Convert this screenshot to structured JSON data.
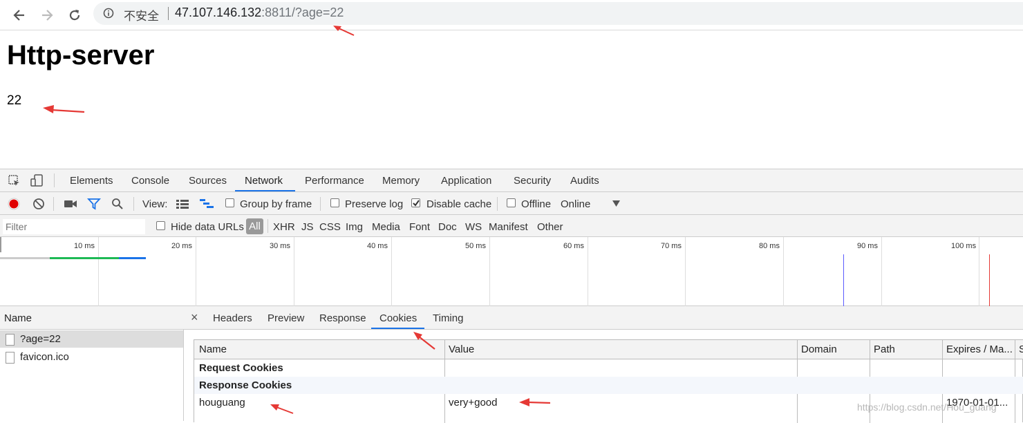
{
  "browser": {
    "security_label": "不安全",
    "url_host": "47.107.146.132",
    "url_rest": ":8811/?age=22"
  },
  "page": {
    "title": "Http-server",
    "value": "22"
  },
  "devtools": {
    "tabs": [
      "Elements",
      "Console",
      "Sources",
      "Network",
      "Performance",
      "Memory",
      "Application",
      "Security",
      "Audits"
    ],
    "active_tab": "Network",
    "toolbar": {
      "view_label": "View:",
      "group_by_frame": "Group by frame",
      "preserve_log": "Preserve log",
      "disable_cache": "Disable cache",
      "offline": "Offline",
      "throttle": "Online"
    },
    "filter": {
      "placeholder": "Filter",
      "hide_data_urls": "Hide data URLs",
      "types": [
        "All",
        "XHR",
        "JS",
        "CSS",
        "Img",
        "Media",
        "Font",
        "Doc",
        "WS",
        "Manifest",
        "Other"
      ]
    },
    "overview_ticks": [
      "10 ms",
      "20 ms",
      "30 ms",
      "40 ms",
      "50 ms",
      "60 ms",
      "70 ms",
      "80 ms",
      "90 ms",
      "100 ms"
    ],
    "requests": {
      "header": "Name",
      "items": [
        "?age=22",
        "favicon.ico"
      ]
    },
    "detail": {
      "close": "×",
      "tabs": [
        "Headers",
        "Preview",
        "Response",
        "Cookies",
        "Timing"
      ],
      "active_tab": "Cookies",
      "cookie_table": {
        "columns": [
          "Name",
          "Value",
          "Domain",
          "Path",
          "Expires / Ma...",
          "S"
        ],
        "section_request": "Request Cookies",
        "section_response": "Response Cookies",
        "rows": [
          {
            "name": "houguang",
            "value": "very+good",
            "domain": "",
            "path": "",
            "expires": "1970-01-01..."
          }
        ]
      }
    }
  },
  "watermark": "https://blog.csdn.net/Hou_guang",
  "colors": {
    "accent": "#1a73e8",
    "record": "#e00000",
    "annotation_arrow": "#e53935"
  }
}
